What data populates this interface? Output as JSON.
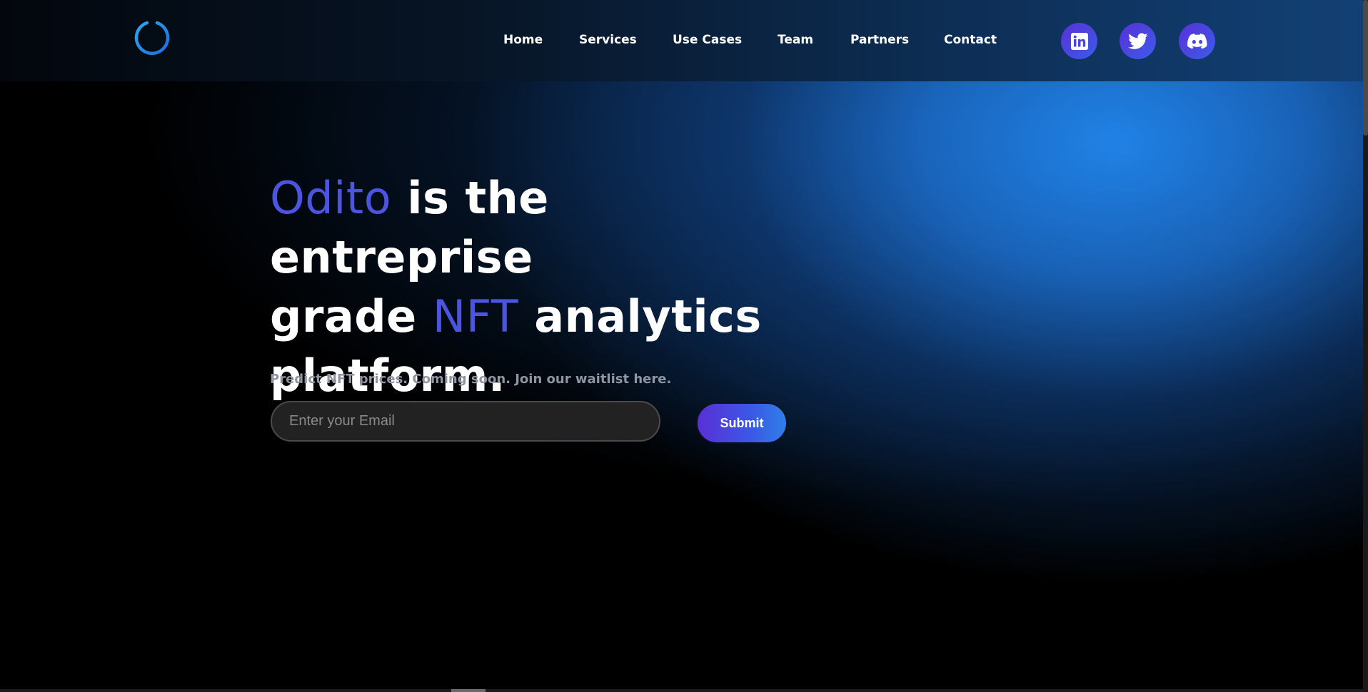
{
  "nav": {
    "items": [
      {
        "label": "Home"
      },
      {
        "label": "Services"
      },
      {
        "label": "Use Cases"
      },
      {
        "label": "Team"
      },
      {
        "label": "Partners"
      },
      {
        "label": "Contact"
      }
    ]
  },
  "social": [
    {
      "icon": "linkedin-icon"
    },
    {
      "icon": "twitter-icon"
    },
    {
      "icon": "discord-icon"
    }
  ],
  "hero": {
    "brand": "Odito",
    "line1_rest": " is the entreprise",
    "line2_start": "grade ",
    "highlight": "NFT",
    "line2_end": " analytics",
    "line3": "platform.",
    "tagline": "Predict NFT prices. Coming soon. Join our waitlist here."
  },
  "form": {
    "email_placeholder": "Enter your Email",
    "email_value": "",
    "submit_label": "Submit"
  },
  "colors": {
    "accent": "#4b55e0",
    "button_start": "#5a2fd6",
    "button_end": "#2f7fe8",
    "glow": "#2082e6"
  }
}
